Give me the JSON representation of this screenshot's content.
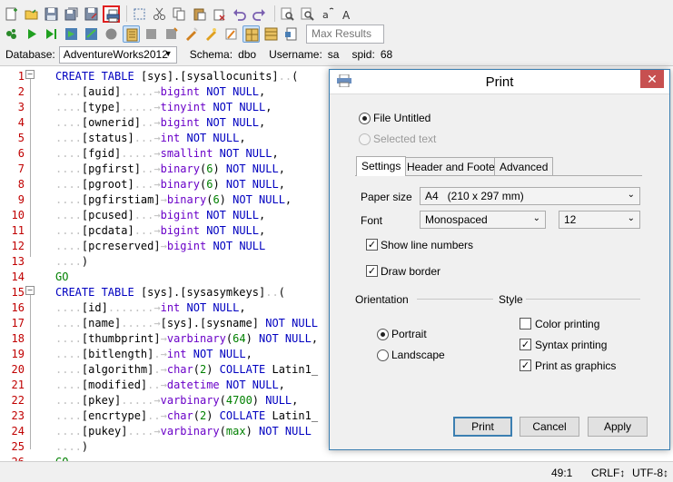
{
  "toolbar": {
    "max_results_placeholder": "Max Results"
  },
  "dbbar": {
    "database_label": "Database:",
    "database_value": "AdventureWorks2012",
    "schema_label": "Schema:",
    "schema_value": "dbo",
    "username_label": "Username:",
    "username_value": "sa",
    "spid_label": "spid:",
    "spid_value": "68"
  },
  "editor": {
    "line_numbers": [
      "1",
      "2",
      "3",
      "4",
      "5",
      "6",
      "7",
      "8",
      "9",
      "10",
      "11",
      "12",
      "13",
      "14",
      "15",
      "16",
      "17",
      "18",
      "19",
      "20",
      "21",
      "22",
      "23",
      "24",
      "25",
      "26"
    ]
  },
  "status": {
    "position": "49:1",
    "line_ending": "CRLF↕",
    "encoding": "UTF-8↕"
  },
  "print_dialog": {
    "title": "Print",
    "close": "✕",
    "file_untitled": "File Untitled",
    "selected_text": "Selected text",
    "tabs": [
      "Settings",
      "Header and Footer",
      "Advanced"
    ],
    "paper_size_label": "Paper size",
    "paper_size_value": "A4   (210 x 297 mm)",
    "font_label": "Font",
    "font_value": "Monospaced",
    "font_size_value": "12",
    "show_line_numbers": "Show line numbers",
    "draw_border": "Draw border",
    "orientation_label": "Orientation",
    "style_label": "Style",
    "portrait": "Portrait",
    "landscape": "Landscape",
    "color_printing": "Color printing",
    "syntax_printing": "Syntax printing",
    "print_as_graphics": "Print as graphics",
    "print_button": "Print",
    "cancel_button": "Cancel",
    "apply_button": "Apply"
  }
}
